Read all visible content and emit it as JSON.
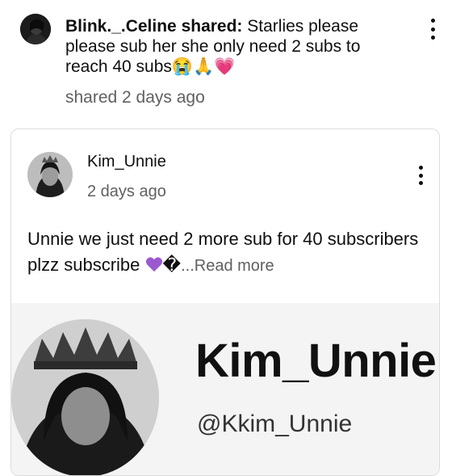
{
  "share": {
    "username": "Blink._.Celine",
    "shared_label": "shared:",
    "message": "Starlies please please sub her she only need 2 subs to reach 40 subs",
    "emojis": "😭🙏💗",
    "time": "shared 2 days ago"
  },
  "post": {
    "author": "Kim_Unnie",
    "time": "2 days ago",
    "text": "Unnie we just need 2 more sub for 40 subscribers plzz subscribe",
    "replacement_char": "�",
    "read_more": "...Read more",
    "image": {
      "name": "Kim_Unnie",
      "handle": "@Kkim_Unnie"
    }
  },
  "icons": {
    "more": "more-vertical-icon",
    "heart": "purple-heart-icon"
  },
  "colors": {
    "secondary_text": "#606060",
    "purple_heart": "#9b59d0"
  }
}
